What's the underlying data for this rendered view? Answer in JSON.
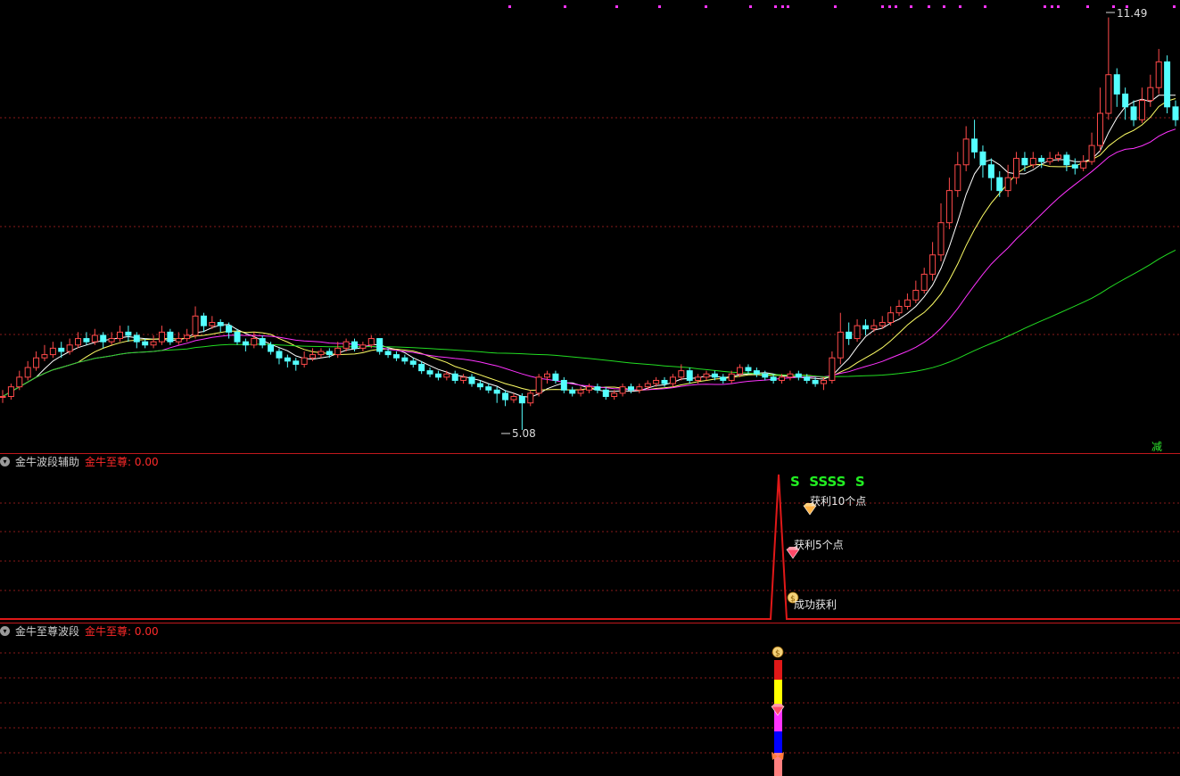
{
  "main_panel": {
    "title_fragment": "",
    "reduce_label": "减",
    "high_label": "11.49",
    "low_label": "5.08"
  },
  "panel2": {
    "name": "金牛波段辅助",
    "value_label": "金牛至尊: 0.00",
    "s_marks": "S  SSSS  S",
    "profit10_label": "获利10个点",
    "profit5_label": "获利5个点",
    "success_label": "成功获利"
  },
  "panel3": {
    "name": "金牛至尊波段",
    "value_label": "金牛至尊: 0.00"
  },
  "colors": {
    "up": "#ff4a4a",
    "down": "#54ffff",
    "ma5": "#ffffff",
    "ma10": "#ffff66",
    "ma20": "#ff33ff",
    "ma60": "#22dd22",
    "indicator_line": "#e01818",
    "grid": "#8a1a1a",
    "separator": "#c0181c"
  },
  "chart_data": {
    "type": "candlestick",
    "price_min": 5.08,
    "price_max": 11.49,
    "grid": true,
    "candles": [
      [
        5.6,
        5.6,
        5.7,
        5.5
      ],
      [
        5.6,
        5.75,
        5.8,
        5.55
      ],
      [
        5.75,
        5.9,
        6.0,
        5.7
      ],
      [
        5.9,
        6.05,
        6.15,
        5.85
      ],
      [
        6.05,
        6.2,
        6.3,
        6.0
      ],
      [
        6.2,
        6.25,
        6.4,
        6.15
      ],
      [
        6.25,
        6.35,
        6.45,
        6.2
      ],
      [
        6.35,
        6.3,
        6.45,
        6.2
      ],
      [
        6.3,
        6.4,
        6.5,
        6.25
      ],
      [
        6.4,
        6.5,
        6.6,
        6.35
      ],
      [
        6.5,
        6.45,
        6.6,
        6.4
      ],
      [
        6.45,
        6.55,
        6.65,
        6.4
      ],
      [
        6.55,
        6.45,
        6.6,
        6.35
      ],
      [
        6.45,
        6.5,
        6.6,
        6.4
      ],
      [
        6.5,
        6.6,
        6.7,
        6.45
      ],
      [
        6.6,
        6.55,
        6.7,
        6.45
      ],
      [
        6.55,
        6.45,
        6.6,
        6.35
      ],
      [
        6.45,
        6.4,
        6.5,
        6.35
      ],
      [
        6.4,
        6.45,
        6.55,
        6.35
      ],
      [
        6.45,
        6.6,
        6.7,
        6.4
      ],
      [
        6.6,
        6.45,
        6.65,
        6.4
      ],
      [
        6.45,
        6.5,
        6.6,
        6.4
      ],
      [
        6.5,
        6.55,
        6.65,
        6.45
      ],
      [
        6.55,
        6.85,
        7.0,
        6.5
      ],
      [
        6.85,
        6.7,
        6.9,
        6.6
      ],
      [
        6.7,
        6.75,
        6.85,
        6.65
      ],
      [
        6.75,
        6.7,
        6.8,
        6.6
      ],
      [
        6.7,
        6.6,
        6.75,
        6.5
      ],
      [
        6.6,
        6.45,
        6.65,
        6.4
      ],
      [
        6.45,
        6.4,
        6.5,
        6.3
      ],
      [
        6.4,
        6.5,
        6.6,
        6.35
      ],
      [
        6.5,
        6.4,
        6.55,
        6.35
      ],
      [
        6.4,
        6.3,
        6.45,
        6.25
      ],
      [
        6.3,
        6.2,
        6.35,
        6.1
      ],
      [
        6.2,
        6.15,
        6.25,
        6.05
      ],
      [
        6.15,
        6.1,
        6.2,
        6.0
      ],
      [
        6.1,
        6.2,
        6.3,
        6.05
      ],
      [
        6.2,
        6.25,
        6.35,
        6.15
      ],
      [
        6.25,
        6.3,
        6.35,
        6.2
      ],
      [
        6.3,
        6.25,
        6.35,
        6.2
      ],
      [
        6.25,
        6.35,
        6.45,
        6.2
      ],
      [
        6.35,
        6.45,
        6.5,
        6.3
      ],
      [
        6.45,
        6.35,
        6.5,
        6.3
      ],
      [
        6.35,
        6.4,
        6.45,
        6.3
      ],
      [
        6.4,
        6.5,
        6.55,
        6.35
      ],
      [
        6.5,
        6.3,
        6.5,
        6.25
      ],
      [
        6.3,
        6.25,
        6.35,
        6.2
      ],
      [
        6.25,
        6.2,
        6.3,
        6.15
      ],
      [
        6.2,
        6.15,
        6.25,
        6.1
      ],
      [
        6.15,
        6.1,
        6.2,
        6.05
      ],
      [
        6.1,
        6.0,
        6.15,
        5.95
      ],
      [
        6.0,
        5.95,
        6.05,
        5.9
      ],
      [
        5.95,
        5.9,
        6.0,
        5.85
      ],
      [
        5.9,
        5.95,
        6.0,
        5.85
      ],
      [
        5.95,
        5.85,
        6.0,
        5.8
      ],
      [
        5.85,
        5.9,
        5.95,
        5.8
      ],
      [
        5.9,
        5.8,
        5.95,
        5.75
      ],
      [
        5.8,
        5.75,
        5.85,
        5.7
      ],
      [
        5.75,
        5.7,
        5.8,
        5.65
      ],
      [
        5.7,
        5.65,
        5.75,
        5.5
      ],
      [
        5.65,
        5.55,
        5.7,
        5.45
      ],
      [
        5.55,
        5.6,
        5.65,
        5.5
      ],
      [
        5.6,
        5.5,
        5.65,
        5.08
      ],
      [
        5.5,
        5.65,
        5.7,
        5.45
      ],
      [
        5.65,
        5.9,
        5.95,
        5.6
      ],
      [
        5.9,
        5.95,
        6.0,
        5.8
      ],
      [
        5.95,
        5.85,
        6.0,
        5.8
      ],
      [
        5.85,
        5.7,
        5.9,
        5.65
      ],
      [
        5.7,
        5.65,
        5.75,
        5.6
      ],
      [
        5.65,
        5.7,
        5.75,
        5.6
      ],
      [
        5.7,
        5.75,
        5.8,
        5.65
      ],
      [
        5.75,
        5.7,
        5.8,
        5.65
      ],
      [
        5.7,
        5.6,
        5.75,
        5.55
      ],
      [
        5.6,
        5.65,
        5.7,
        5.55
      ],
      [
        5.65,
        5.75,
        5.8,
        5.6
      ],
      [
        5.75,
        5.7,
        5.8,
        5.65
      ],
      [
        5.7,
        5.75,
        5.8,
        5.65
      ],
      [
        5.75,
        5.8,
        5.85,
        5.7
      ],
      [
        5.8,
        5.85,
        5.9,
        5.75
      ],
      [
        5.85,
        5.8,
        5.9,
        5.75
      ],
      [
        5.8,
        5.9,
        5.95,
        5.75
      ],
      [
        5.9,
        6.0,
        6.1,
        5.85
      ],
      [
        6.0,
        5.85,
        6.05,
        5.8
      ],
      [
        5.85,
        5.9,
        5.95,
        5.8
      ],
      [
        5.9,
        5.95,
        6.0,
        5.85
      ],
      [
        5.95,
        5.9,
        6.0,
        5.85
      ],
      [
        5.9,
        5.85,
        5.95,
        5.8
      ],
      [
        5.85,
        5.95,
        6.0,
        5.8
      ],
      [
        5.95,
        6.05,
        6.1,
        5.9
      ],
      [
        6.05,
        6.0,
        6.1,
        5.95
      ],
      [
        6.0,
        5.95,
        6.05,
        5.9
      ],
      [
        5.95,
        5.9,
        6.0,
        5.85
      ],
      [
        5.9,
        5.85,
        5.95,
        5.8
      ],
      [
        5.85,
        5.9,
        5.95,
        5.8
      ],
      [
        5.9,
        5.95,
        6.0,
        5.85
      ],
      [
        5.95,
        5.9,
        6.0,
        5.85
      ],
      [
        5.9,
        5.85,
        5.95,
        5.8
      ],
      [
        5.85,
        5.8,
        5.9,
        5.75
      ],
      [
        5.8,
        5.85,
        5.9,
        5.7
      ],
      [
        5.85,
        6.2,
        6.3,
        5.8
      ],
      [
        6.2,
        6.6,
        6.9,
        6.1
      ],
      [
        6.6,
        6.5,
        6.75,
        6.4
      ],
      [
        6.5,
        6.7,
        6.8,
        6.45
      ],
      [
        6.7,
        6.65,
        6.8,
        6.55
      ],
      [
        6.65,
        6.7,
        6.8,
        6.6
      ],
      [
        6.7,
        6.75,
        6.85,
        6.65
      ],
      [
        6.75,
        6.9,
        7.0,
        6.7
      ],
      [
        6.9,
        7.0,
        7.1,
        6.85
      ],
      [
        7.0,
        7.1,
        7.2,
        6.95
      ],
      [
        7.1,
        7.25,
        7.4,
        7.05
      ],
      [
        7.25,
        7.5,
        7.6,
        7.2
      ],
      [
        7.5,
        7.8,
        8.0,
        7.4
      ],
      [
        7.8,
        8.3,
        8.6,
        7.7
      ],
      [
        8.3,
        8.8,
        9.0,
        8.2
      ],
      [
        8.8,
        9.2,
        9.4,
        8.7
      ],
      [
        9.2,
        9.6,
        9.8,
        9.1
      ],
      [
        9.6,
        9.4,
        9.9,
        9.3
      ],
      [
        9.4,
        9.2,
        9.5,
        9.0
      ],
      [
        9.2,
        9.0,
        9.3,
        8.8
      ],
      [
        9.0,
        8.8,
        9.1,
        8.7
      ],
      [
        8.8,
        9.0,
        9.2,
        8.7
      ],
      [
        9.0,
        9.3,
        9.4,
        8.9
      ],
      [
        9.3,
        9.2,
        9.4,
        9.1
      ],
      [
        9.2,
        9.3,
        9.4,
        9.15
      ],
      [
        9.3,
        9.25,
        9.35,
        9.15
      ],
      [
        9.25,
        9.3,
        9.4,
        9.2
      ],
      [
        9.3,
        9.35,
        9.4,
        9.25
      ],
      [
        9.35,
        9.2,
        9.4,
        9.1
      ],
      [
        9.2,
        9.15,
        9.3,
        9.05
      ],
      [
        9.15,
        9.25,
        9.35,
        9.1
      ],
      [
        9.25,
        9.5,
        9.7,
        9.2
      ],
      [
        9.5,
        10.0,
        10.4,
        9.4
      ],
      [
        10.0,
        10.6,
        11.49,
        9.9
      ],
      [
        10.6,
        10.3,
        10.7,
        10.1
      ],
      [
        10.3,
        10.1,
        10.4,
        9.9
      ],
      [
        10.1,
        9.9,
        10.2,
        9.8
      ],
      [
        9.9,
        10.2,
        10.4,
        9.85
      ],
      [
        10.2,
        10.4,
        10.6,
        10.1
      ],
      [
        10.4,
        10.8,
        11.0,
        10.3
      ],
      [
        10.8,
        10.1,
        10.9,
        10.0
      ],
      [
        10.1,
        9.9,
        10.2,
        9.8
      ]
    ],
    "panel2_spike": {
      "peak_value": 1.0,
      "baseline": 0.0
    },
    "panel3_bar_colors": [
      "#e01818",
      "#ffff00",
      "#ff33ff",
      "#0000ff",
      "#ff8080"
    ]
  }
}
